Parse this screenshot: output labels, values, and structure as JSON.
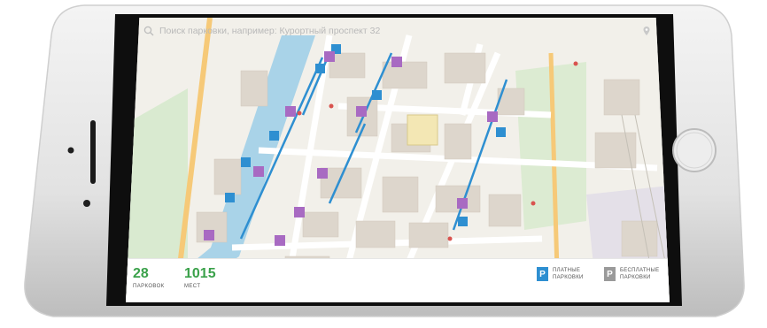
{
  "search": {
    "placeholder": "Поиск парковки, например: Курортный проспект 32"
  },
  "stats": [
    {
      "value": "28",
      "label": "ПАРКОВОК"
    },
    {
      "value": "1015",
      "label": "МЕСТ"
    }
  ],
  "legend": [
    {
      "glyph": "P",
      "line1": "ПЛАТНЫЕ",
      "line2": "ПАРКОВКИ",
      "color": "#2e8fd1"
    },
    {
      "glyph": "P",
      "line1": "БЕСПЛАТНЫЕ",
      "line2": "ПАРКОВКИ",
      "color": "#9a9a9a"
    }
  ],
  "colors": {
    "river": "#a9d3e8",
    "paid_marker": "#2e8fd1",
    "free_marker": "#a86ac2",
    "accent_green": "#3aa14a"
  }
}
